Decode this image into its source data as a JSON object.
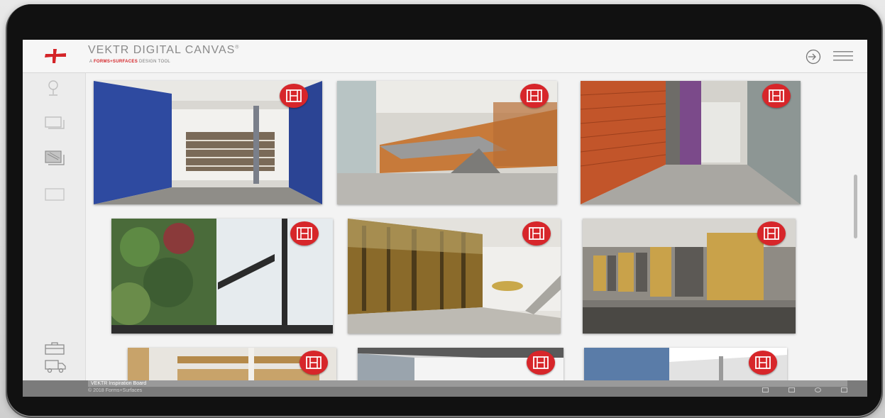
{
  "header": {
    "title": "VEKTR DIGITAL CANVAS",
    "title_mark": "®",
    "subtitle_prefix": "A",
    "subtitle_brand": "FORMS+SURFACES",
    "subtitle_suffix": "DESIGN TOOL",
    "icons": [
      "login-icon",
      "hamburger-menu-icon"
    ]
  },
  "sidebar": {
    "top_items": [
      {
        "icon": "pin-icon"
      },
      {
        "icon": "panel-icon"
      },
      {
        "icon": "layers-icon"
      },
      {
        "icon": "frame-icon"
      }
    ],
    "bottom_items": [
      {
        "icon": "briefcase-icon"
      },
      {
        "icon": "truck-icon"
      }
    ]
  },
  "gallery": {
    "tiles": [
      {
        "scene": "library-blue-tile-wall",
        "colors": [
          "#2e4aa0",
          "#c9c7c2",
          "#7a6a58"
        ]
      },
      {
        "scene": "atrium-staircase",
        "colors": [
          "#c77a3a",
          "#d9d6cf",
          "#8c8a86"
        ]
      },
      {
        "scene": "orange-glass-corridor",
        "colors": [
          "#c2552a",
          "#cfcdc8",
          "#6e6c68"
        ]
      },
      {
        "scene": "forest-glass-window",
        "colors": [
          "#4a6b3a",
          "#cfd4d8",
          "#2b2b2b"
        ]
      },
      {
        "scene": "forest-mural-lobby",
        "colors": [
          "#8a6a2a",
          "#e4e2dd",
          "#bdbab3"
        ]
      },
      {
        "scene": "elevator-bamboo-panels",
        "colors": [
          "#c9a24a",
          "#8f8b84",
          "#4a4844"
        ]
      },
      {
        "scene": "wood-panel-office",
        "colors": [
          "#c8a36a",
          "#e8e5df",
          "#b58a4a"
        ]
      },
      {
        "scene": "white-ceiling-hall",
        "colors": [
          "#d8d8d8",
          "#9aa4ad",
          "#ffffff"
        ]
      },
      {
        "scene": "blue-glass-atrium",
        "colors": [
          "#5a7ca8",
          "#e2e2e2",
          "#9a9a9a"
        ]
      }
    ],
    "film_icon": "film-strip-icon",
    "accent": "#d7262a"
  },
  "footer": {
    "board_label": "VEKTR Inspiration Board",
    "copyright": "© 2018 Forms+Surfaces",
    "icons": [
      "share-icon",
      "camera-icon",
      "settings-icon",
      "window-icon"
    ]
  }
}
